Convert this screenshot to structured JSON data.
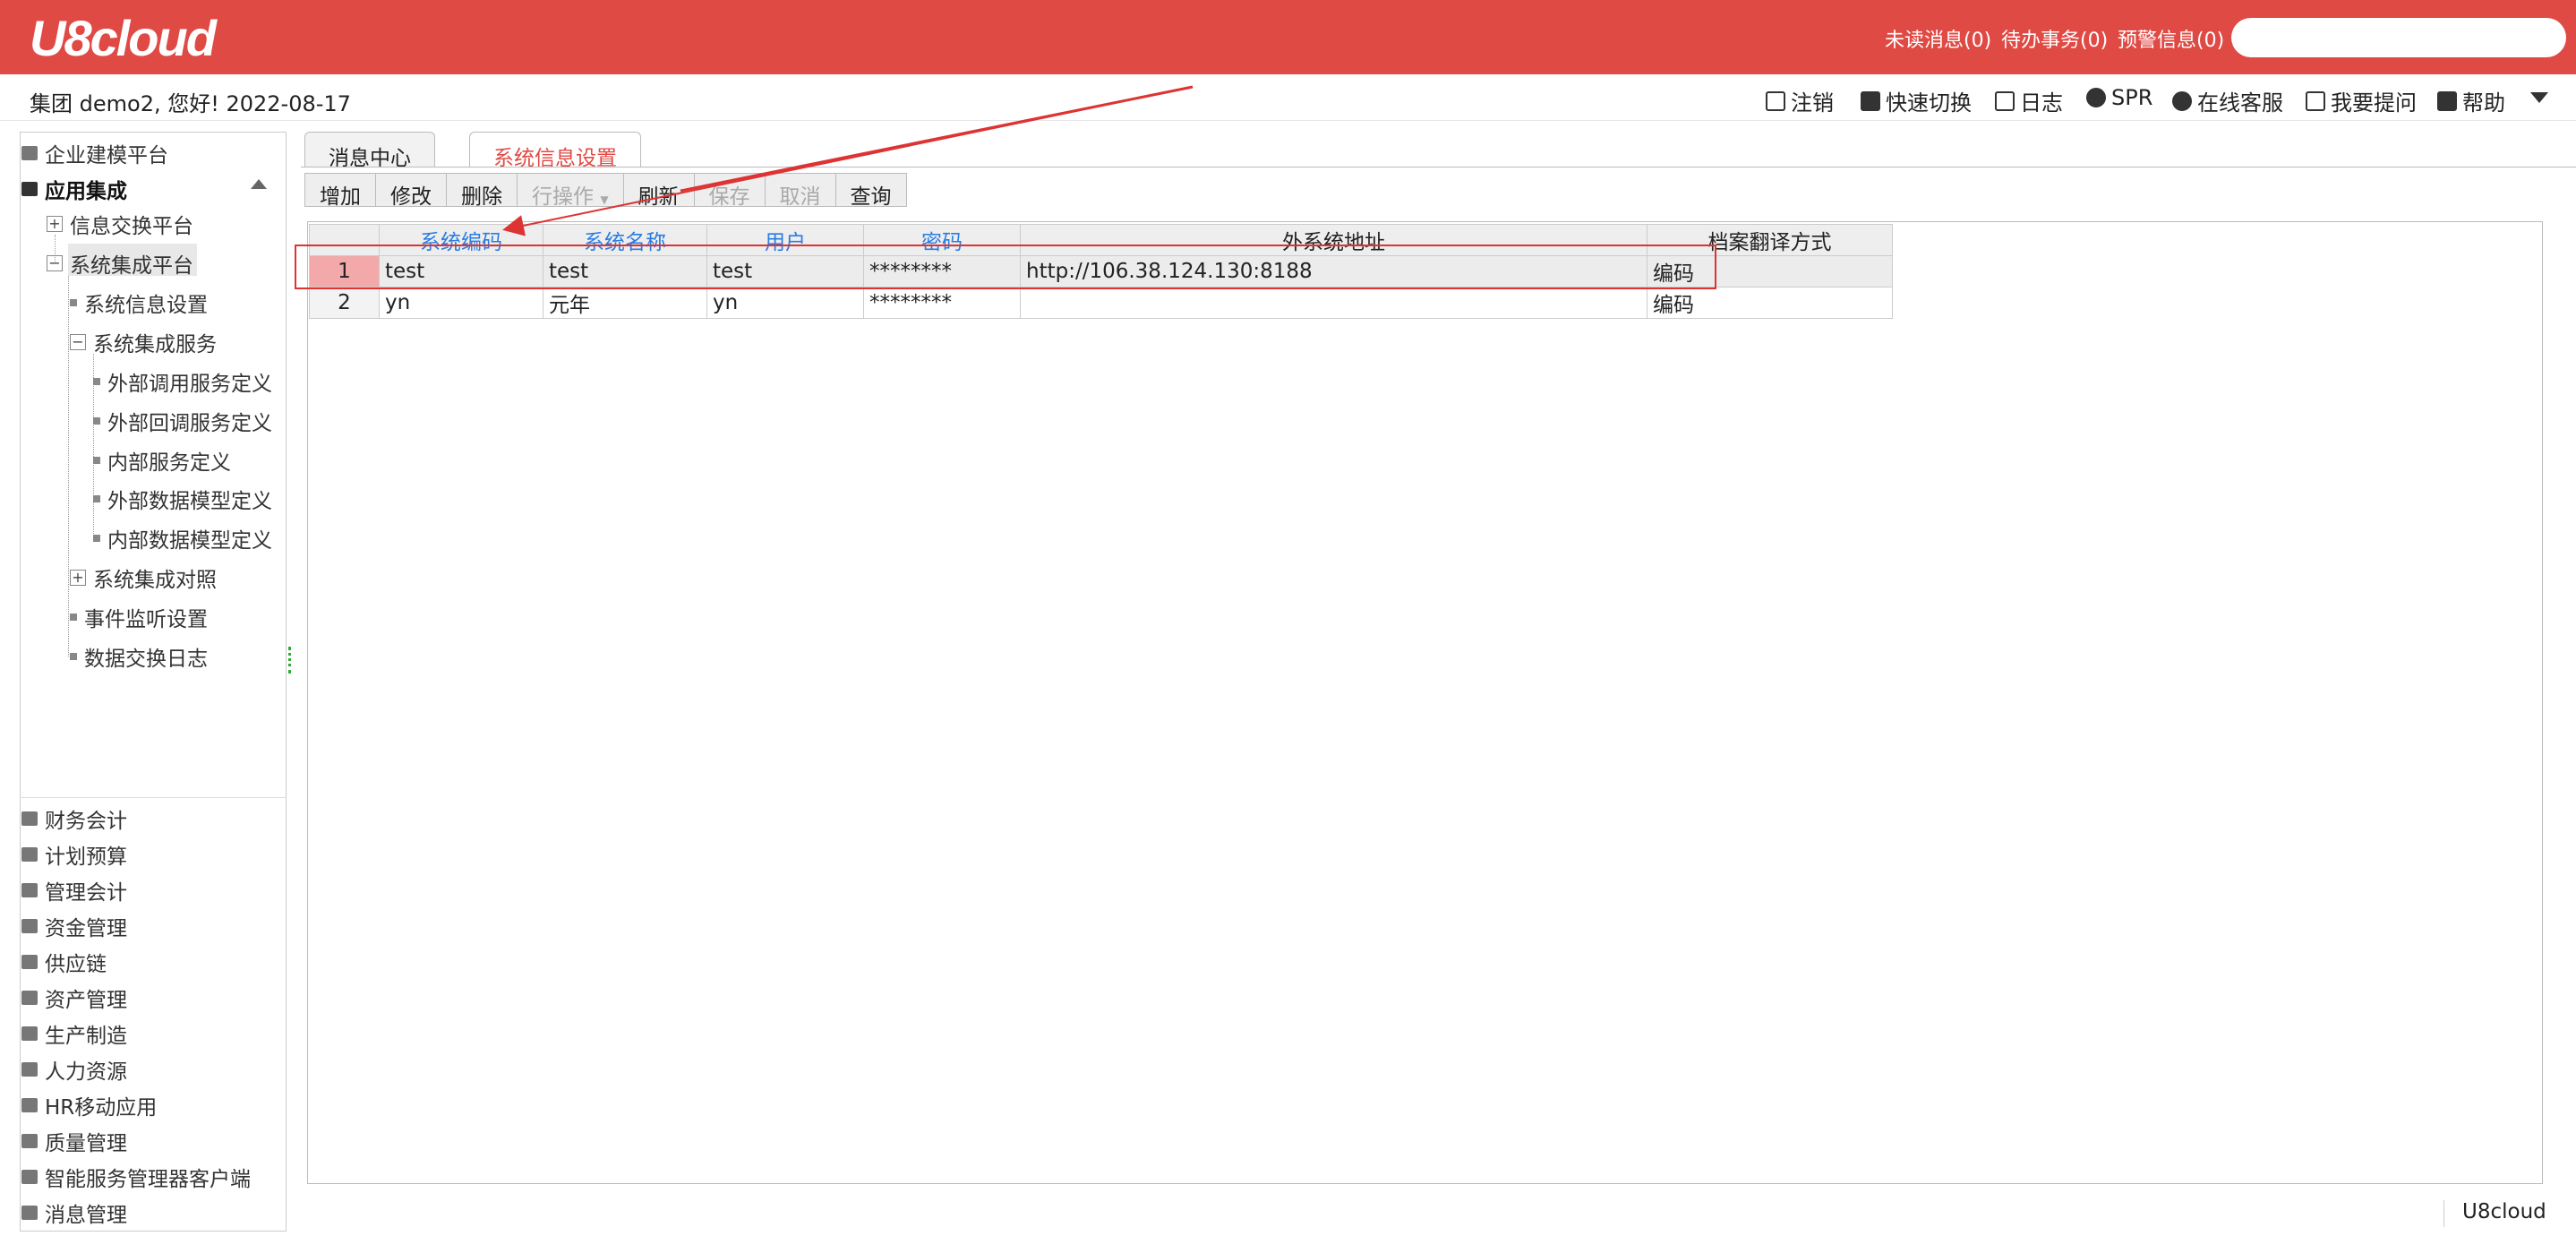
{
  "header": {
    "logo": "U8cloud",
    "unread": "未读消息(0)",
    "todo": "待办事务(0)",
    "alerts": "预警信息(0)",
    "search_value": ""
  },
  "infobar": {
    "greeting": "集团 demo2, 您好! 2022-08-17",
    "tools": [
      "注销",
      "快速切换",
      "日志",
      "SPR",
      "在线客服",
      "我要提问",
      "帮助"
    ]
  },
  "sidebar": {
    "top_items": [
      "企业建模平台",
      "应用集成"
    ],
    "tree": {
      "info_exchange": "信息交换平台",
      "sys_integration": "系统集成平台",
      "sys_info_setting": "系统信息设置",
      "sys_integration_service": "系统集成服务",
      "service_children": [
        "外部调用服务定义",
        "外部回调服务定义",
        "内部服务定义",
        "外部数据模型定义",
        "内部数据模型定义"
      ],
      "sys_integration_mapping": "系统集成对照",
      "event_listen": "事件监听设置",
      "data_exchange_log": "数据交换日志"
    },
    "modules": [
      "财务会计",
      "计划预算",
      "管理会计",
      "资金管理",
      "供应链",
      "资产管理",
      "生产制造",
      "人力资源",
      "HR移动应用",
      "质量管理",
      "智能服务管理器客户端",
      "消息管理"
    ]
  },
  "tabs": [
    "消息中心",
    "系统信息设置"
  ],
  "toolbar": [
    "增加",
    "修改",
    "删除",
    "行操作",
    "刷新",
    "保存",
    "取消",
    "查询"
  ],
  "grid": {
    "columns": [
      "系统编码",
      "系统名称",
      "用户",
      "密码",
      "外系统地址",
      "档案翻译方式"
    ],
    "rows": [
      {
        "num": "1",
        "code": "test",
        "name": "test",
        "user": "test",
        "password": "********",
        "address": "http://106.38.124.130:8188",
        "mode": "编码"
      },
      {
        "num": "2",
        "code": "yn",
        "name": "元年",
        "user": "yn",
        "password": "********",
        "address": "",
        "mode": "编码"
      }
    ]
  },
  "status": {
    "brand": "U8cloud"
  },
  "colors": {
    "brand_red": "#e04a45",
    "header_link_blue": "#2a7de1"
  }
}
